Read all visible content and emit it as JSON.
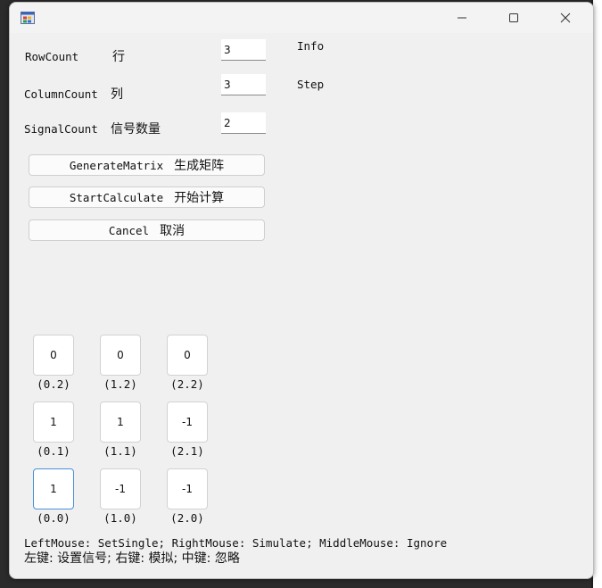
{
  "labels": {
    "row_count": "RowCount",
    "row_count_cn": "行",
    "column_count": "ColumnCount",
    "column_count_cn": "列",
    "signal_count": "SignalCount",
    "signal_count_cn": "信号数量",
    "info": "Info",
    "step": "Step"
  },
  "inputs": {
    "row_count": "3",
    "column_count": "3",
    "signal_count": "2"
  },
  "buttons": {
    "generate": "GenerateMatrix",
    "generate_cn": "生成矩阵",
    "start": "StartCalculate",
    "start_cn": "开始计算",
    "cancel": "Cancel",
    "cancel_cn": "取消"
  },
  "matrix": {
    "rows": [
      {
        "cells": [
          {
            "value": "0",
            "coord": "(0.2)"
          },
          {
            "value": "0",
            "coord": "(1.2)"
          },
          {
            "value": "0",
            "coord": "(2.2)"
          }
        ]
      },
      {
        "cells": [
          {
            "value": "1",
            "coord": "(0.1)"
          },
          {
            "value": "1",
            "coord": "(1.1)"
          },
          {
            "value": "-1",
            "coord": "(2.1)"
          }
        ]
      },
      {
        "cells": [
          {
            "value": "1",
            "coord": "(0.0)"
          },
          {
            "value": "-1",
            "coord": "(1.0)"
          },
          {
            "value": "-1",
            "coord": "(2.0)"
          }
        ]
      }
    ]
  },
  "help": {
    "en": "LeftMouse: SetSingle; RightMouse: Simulate; MiddleMouse: Ignore",
    "cn": "左键: 设置信号; 右键: 模拟; 中键: 忽略"
  },
  "colors": {
    "window_bg": "#f0f0f0",
    "focus_border": "#4a90d9"
  },
  "icons": {
    "app": "app-window-icon",
    "minimize": "minimize-icon",
    "maximize": "maximize-icon",
    "close": "close-icon"
  }
}
